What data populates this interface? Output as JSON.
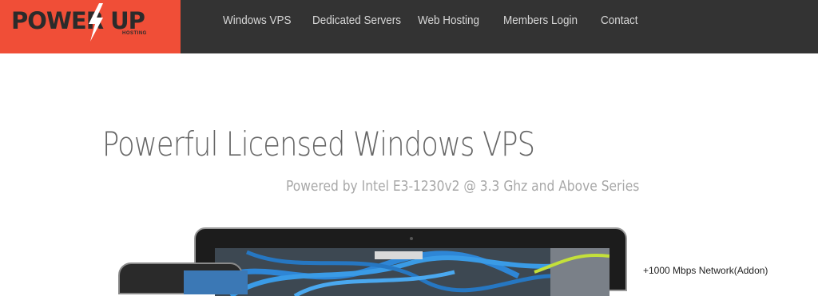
{
  "brand": {
    "logo_text": "POWER UP",
    "logo_sub": "HOSTING",
    "accent_color": "#f04e37",
    "nav_bg": "#333333"
  },
  "nav": {
    "items": [
      {
        "label": "Windows VPS"
      },
      {
        "label": "Dedicated Servers"
      },
      {
        "label": "Web Hosting"
      },
      {
        "label": "Members Login"
      },
      {
        "label": "Contact"
      }
    ]
  },
  "hero": {
    "title": "Powerful Licensed Windows VPS",
    "subtitle": "Powered by Intel E3-1230v2 @ 3.3 Ghz and Above Series"
  },
  "features": {
    "items": [
      {
        "label": "+1000 Mbps Network(Addon)"
      }
    ]
  }
}
